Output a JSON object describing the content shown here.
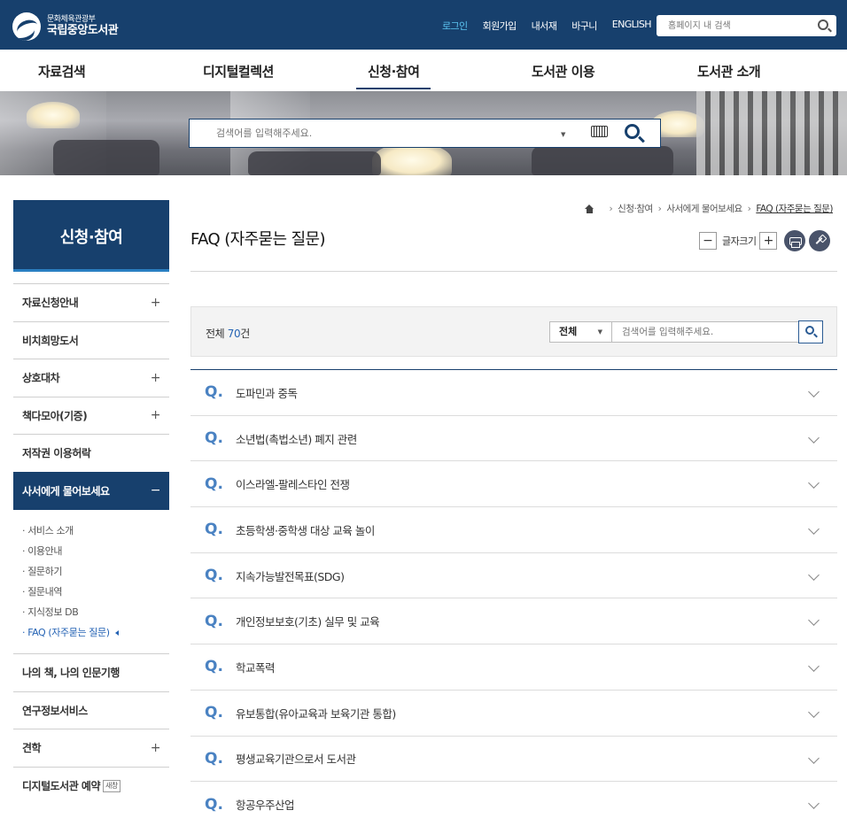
{
  "header": {
    "logo_sub": "문화체육관광부",
    "logo_main": "국립중앙도서관",
    "util_links": [
      "로그인",
      "회원가입",
      "내서재",
      "바구니",
      "ENGLISH"
    ],
    "search_placeholder": "홈페이지 내 검색"
  },
  "gnb": [
    "자료검색",
    "디지털컬렉션",
    "신청·참여",
    "도서관 이용",
    "도서관 소개"
  ],
  "gnb_active": "신청·참여",
  "main_search": {
    "placeholder": "검색어를 입력해주세요."
  },
  "sidebar": {
    "title": "신청·참여",
    "items": [
      {
        "label": "자료신청안내",
        "toggle": "+"
      },
      {
        "label": "비치희망도서",
        "toggle": ""
      },
      {
        "label": "상호대차",
        "toggle": "+"
      },
      {
        "label": "책다모아(기증)",
        "toggle": "+"
      },
      {
        "label": "저작권 이용허락",
        "toggle": ""
      },
      {
        "label": "사서에게 물어보세요",
        "toggle": "−"
      }
    ],
    "sub_items": [
      "서비스 소개",
      "이용안내",
      "질문하기",
      "질문내역",
      "지식정보 DB",
      "FAQ (자주묻는 질문)"
    ],
    "items_after": [
      {
        "label": "나의 책, 나의 인문기행",
        "toggle": ""
      },
      {
        "label": "연구정보서비스",
        "toggle": ""
      },
      {
        "label": "견학",
        "toggle": "+"
      },
      {
        "label": "디지털도서관 예약",
        "toggle": "",
        "badge": "새창"
      }
    ]
  },
  "breadcrumb": [
    "신청·참여",
    "사서에게 물어보세요",
    "FAQ (자주묻는 질문)"
  ],
  "page_title": "FAQ (자주묻는 질문)",
  "font_size_label": "글자크기",
  "font_minus": "−",
  "font_plus": "+",
  "search_box": {
    "total_prefix": "전체 ",
    "total_count": "70",
    "total_suffix": "건",
    "select_value": "전체",
    "placeholder": "검색어를 입력해주세요."
  },
  "faq_marker": "Q.",
  "faq": [
    "도파민과 중독",
    "소년법(촉법소년) 폐지 관련",
    "이스라엘-팔레스타인 전쟁",
    "초등학생·중학생 대상 교육 놀이",
    "지속가능발전목표(SDG)",
    "개인정보보호(기초) 실무 및 교육",
    "학교폭력",
    "유보통합(유아교육과 보육기관 통합)",
    "평생교육기관으로서 도서관",
    "항공우주산업"
  ],
  "colors": {
    "primary": "#17406d",
    "accent": "#5cc5f2",
    "link": "#2563b4",
    "q_marker": "#4a82c2"
  }
}
